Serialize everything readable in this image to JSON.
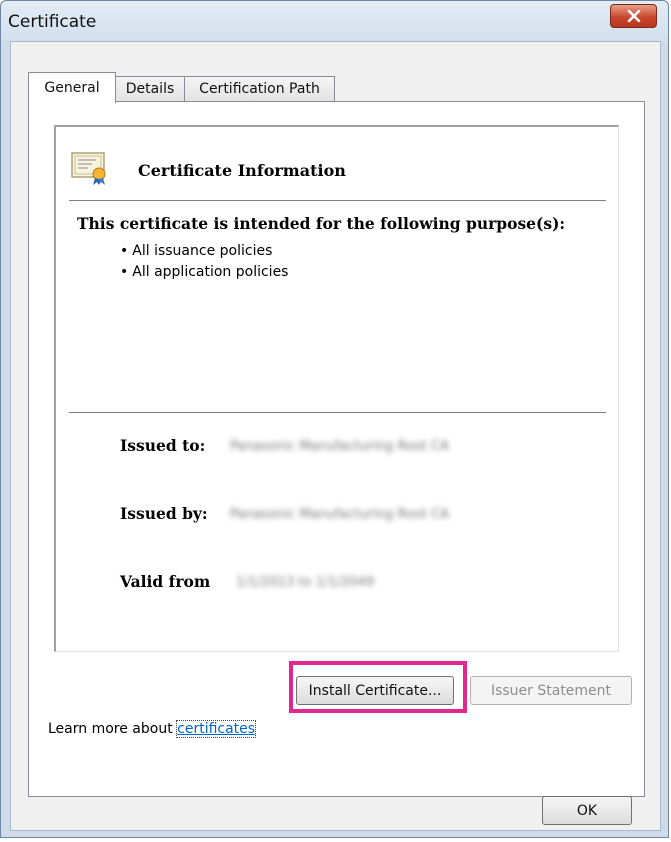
{
  "window": {
    "title": "Certificate",
    "close_icon": "close-icon"
  },
  "tabs": [
    {
      "label": "General",
      "active": true
    },
    {
      "label": "Details",
      "active": false
    },
    {
      "label": "Certification Path",
      "active": false
    }
  ],
  "info": {
    "icon": "certificate-icon",
    "header": "Certificate Information",
    "purpose_heading": "This certificate is intended for the following purpose(s):",
    "purposes": [
      "All issuance policies",
      "All application policies"
    ],
    "issued_to_label": "Issued to:",
    "issued_to_value": "Panasonic Manufacturing Root CA",
    "issued_by_label": "Issued by:",
    "issued_by_value": "Panasonic Manufacturing Root CA",
    "valid_from_label": "Valid from",
    "valid_from_value": "1/1/2013 to 1/1/2049"
  },
  "buttons": {
    "install": "Install Certificate...",
    "issuer_statement": "Issuer Statement",
    "ok": "OK"
  },
  "learn_more": {
    "prefix": "Learn more about ",
    "link": "certificates"
  },
  "colors": {
    "highlight": "#e0288f",
    "link": "#0066cc",
    "close_button": "#c9472e"
  }
}
